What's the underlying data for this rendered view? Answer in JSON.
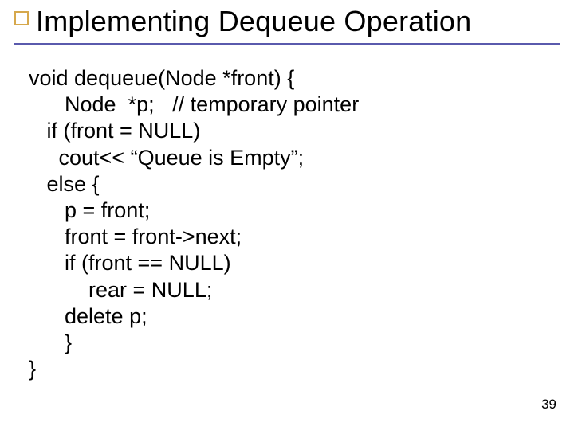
{
  "slide": {
    "title": "Implementing Dequeue Operation",
    "page_number": "39"
  },
  "code": {
    "l1": "void dequeue(Node *front) {",
    "l2": "      Node  *p;   // temporary pointer",
    "l3": "   if (front = NULL)",
    "l4": "     cout<< “Queue is Empty”;",
    "l5": "   else {",
    "l6": "      p = front;",
    "l7": "      front = front->next;",
    "l8": "      if (front == NULL)",
    "l9": "          rear = NULL;",
    "l10": "      delete p;",
    "l11": "      }",
    "l12": "}"
  }
}
